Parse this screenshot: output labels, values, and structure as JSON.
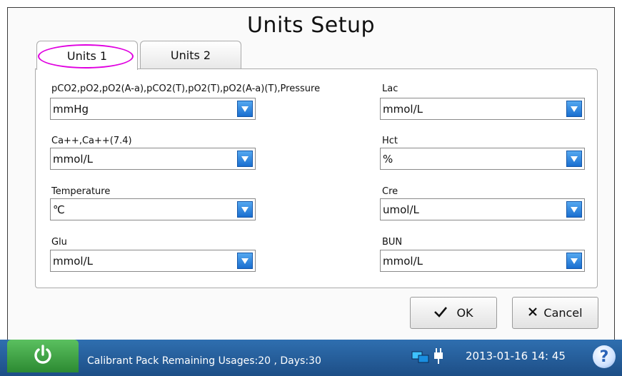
{
  "title": "Units Setup",
  "tabs": [
    {
      "label": "Units 1",
      "active": true
    },
    {
      "label": "Units 2",
      "active": false
    }
  ],
  "fields": {
    "pressure": {
      "label": "pCO2,pO2,pO2(A-a),pCO2(T),pO2(T),pO2(A-a)(T),Pressure",
      "value": "mmHg"
    },
    "ca": {
      "label": "Ca++,Ca++(7.4)",
      "value": "mmol/L"
    },
    "temperature": {
      "label": "Temperature",
      "value": "℃"
    },
    "glu": {
      "label": "Glu",
      "value": "mmol/L"
    },
    "lac": {
      "label": "Lac",
      "value": "mmol/L"
    },
    "hct": {
      "label": "Hct",
      "value": "%"
    },
    "cre": {
      "label": "Cre",
      "value": "umol/L"
    },
    "bun": {
      "label": "BUN",
      "value": "mmol/L"
    }
  },
  "buttons": {
    "ok": "OK",
    "cancel": "Cancel"
  },
  "status": {
    "message": "Calibrant Pack Remaining Usages:20 , Days:30",
    "datetime": "2013-01-16  14: 45",
    "help": "?"
  },
  "colors": {
    "accent": "#1a6fd0",
    "highlight": "#e000e0",
    "statusbar": "#2f6fb0",
    "power": "#3fa544"
  },
  "icons": [
    "power-icon",
    "network-icon",
    "plug-icon",
    "help-icon",
    "check-icon",
    "x-icon",
    "dropdown-arrow-icon"
  ]
}
